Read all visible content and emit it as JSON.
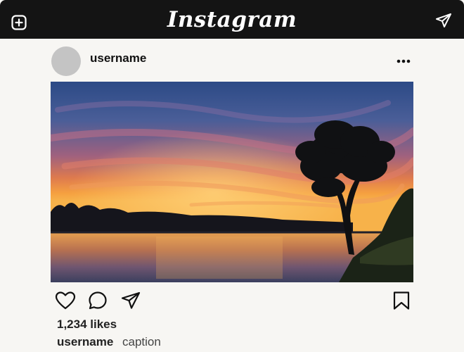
{
  "app": {
    "logo_text": "Instagram"
  },
  "icons": {
    "new_post": "plus-square-icon",
    "direct": "paper-plane-icon",
    "more": "more-dots-icon",
    "like": "heart-icon",
    "comment": "comment-bubble-icon",
    "share": "paper-plane-icon",
    "save": "bookmark-icon"
  },
  "post": {
    "username": "username",
    "image_alt": "Sunset over a calm lake with a silhouetted tree",
    "likes_text": "1,234 likes",
    "caption_username": "username",
    "caption_text": "caption"
  },
  "colors": {
    "topbar": "#141414",
    "page_bg": "#f7f6f3",
    "avatar": "#c4c4c4"
  }
}
